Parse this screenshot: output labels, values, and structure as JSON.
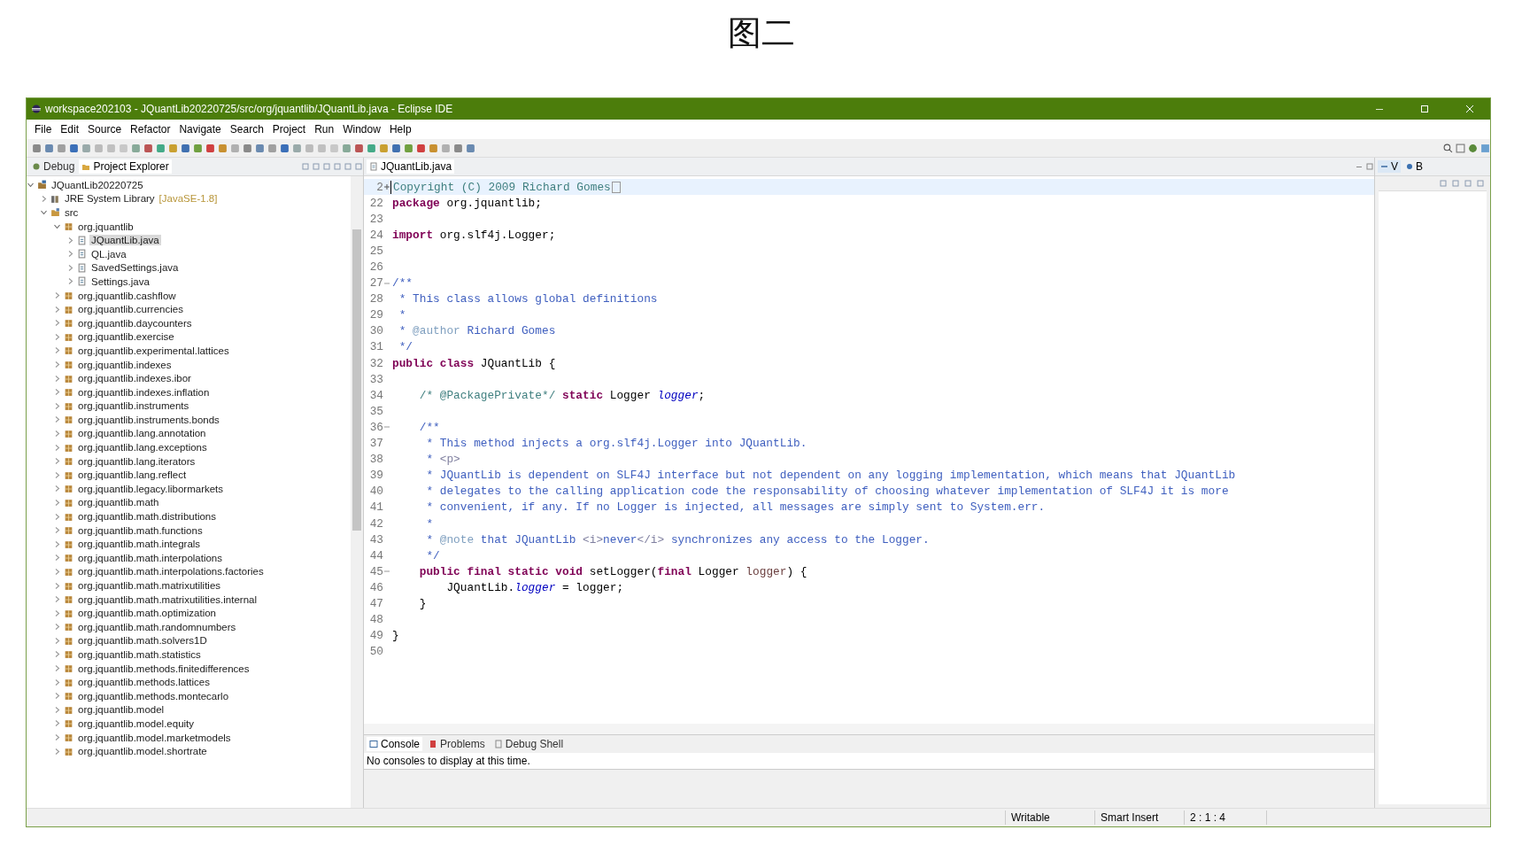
{
  "caption": "图二",
  "window": {
    "title": "workspace202103 - JQuantLib20220725/src/org/jquantlib/JQuantLib.java - Eclipse IDE"
  },
  "menu": [
    "File",
    "Edit",
    "Source",
    "Refactor",
    "Navigate",
    "Search",
    "Project",
    "Run",
    "Window",
    "Help"
  ],
  "left_panel": {
    "tabs": [
      {
        "label": "Debug",
        "selected": false
      },
      {
        "label": "Project Explorer",
        "selected": true
      }
    ],
    "tree": [
      {
        "label": "JQuantLib20220725",
        "kind": "project",
        "expanded": true,
        "selected": false,
        "children": [
          {
            "label": "JRE System Library",
            "decoration": "[JavaSE-1.8]",
            "kind": "library",
            "expanded": false,
            "selected": false
          },
          {
            "label": "src",
            "kind": "folder",
            "expanded": true,
            "selected": false,
            "children": [
              {
                "label": "org.jquantlib",
                "kind": "package",
                "expanded": true,
                "selected": false,
                "children": [
                  {
                    "label": "JQuantLib.java",
                    "kind": "file",
                    "expanded": false,
                    "selected": true
                  },
                  {
                    "label": "QL.java",
                    "kind": "file",
                    "expanded": false,
                    "selected": false
                  },
                  {
                    "label": "SavedSettings.java",
                    "kind": "file",
                    "expanded": false,
                    "selected": false
                  },
                  {
                    "label": "Settings.java",
                    "kind": "file",
                    "expanded": false,
                    "selected": false
                  }
                ]
              },
              {
                "label": "org.jquantlib.cashflow",
                "kind": "package",
                "expanded": false,
                "selected": false
              },
              {
                "label": "org.jquantlib.currencies",
                "kind": "package",
                "expanded": false,
                "selected": false
              },
              {
                "label": "org.jquantlib.daycounters",
                "kind": "package",
                "expanded": false,
                "selected": false
              },
              {
                "label": "org.jquantlib.exercise",
                "kind": "package",
                "expanded": false,
                "selected": false
              },
              {
                "label": "org.jquantlib.experimental.lattices",
                "kind": "package",
                "expanded": false,
                "selected": false
              },
              {
                "label": "org.jquantlib.indexes",
                "kind": "package",
                "expanded": false,
                "selected": false
              },
              {
                "label": "org.jquantlib.indexes.ibor",
                "kind": "package",
                "expanded": false,
                "selected": false
              },
              {
                "label": "org.jquantlib.indexes.inflation",
                "kind": "package",
                "expanded": false,
                "selected": false
              },
              {
                "label": "org.jquantlib.instruments",
                "kind": "package",
                "expanded": false,
                "selected": false
              },
              {
                "label": "org.jquantlib.instruments.bonds",
                "kind": "package",
                "expanded": false,
                "selected": false
              },
              {
                "label": "org.jquantlib.lang.annotation",
                "kind": "package",
                "expanded": false,
                "selected": false
              },
              {
                "label": "org.jquantlib.lang.exceptions",
                "kind": "package",
                "expanded": false,
                "selected": false
              },
              {
                "label": "org.jquantlib.lang.iterators",
                "kind": "package",
                "expanded": false,
                "selected": false
              },
              {
                "label": "org.jquantlib.lang.reflect",
                "kind": "package",
                "expanded": false,
                "selected": false
              },
              {
                "label": "org.jquantlib.legacy.libormarkets",
                "kind": "package",
                "expanded": false,
                "selected": false
              },
              {
                "label": "org.jquantlib.math",
                "kind": "package",
                "expanded": false,
                "selected": false
              },
              {
                "label": "org.jquantlib.math.distributions",
                "kind": "package",
                "expanded": false,
                "selected": false
              },
              {
                "label": "org.jquantlib.math.functions",
                "kind": "package",
                "expanded": false,
                "selected": false
              },
              {
                "label": "org.jquantlib.math.integrals",
                "kind": "package",
                "expanded": false,
                "selected": false
              },
              {
                "label": "org.jquantlib.math.interpolations",
                "kind": "package",
                "expanded": false,
                "selected": false
              },
              {
                "label": "org.jquantlib.math.interpolations.factories",
                "kind": "package",
                "expanded": false,
                "selected": false
              },
              {
                "label": "org.jquantlib.math.matrixutilities",
                "kind": "package",
                "expanded": false,
                "selected": false
              },
              {
                "label": "org.jquantlib.math.matrixutilities.internal",
                "kind": "package",
                "expanded": false,
                "selected": false
              },
              {
                "label": "org.jquantlib.math.optimization",
                "kind": "package",
                "expanded": false,
                "selected": false
              },
              {
                "label": "org.jquantlib.math.randomnumbers",
                "kind": "package",
                "expanded": false,
                "selected": false
              },
              {
                "label": "org.jquantlib.math.solvers1D",
                "kind": "package",
                "expanded": false,
                "selected": false
              },
              {
                "label": "org.jquantlib.math.statistics",
                "kind": "package",
                "expanded": false,
                "selected": false
              },
              {
                "label": "org.jquantlib.methods.finitedifferences",
                "kind": "package",
                "expanded": false,
                "selected": false
              },
              {
                "label": "org.jquantlib.methods.lattices",
                "kind": "package",
                "expanded": false,
                "selected": false
              },
              {
                "label": "org.jquantlib.methods.montecarlo",
                "kind": "package",
                "expanded": false,
                "selected": false
              },
              {
                "label": "org.jquantlib.model",
                "kind": "package",
                "expanded": false,
                "selected": false
              },
              {
                "label": "org.jquantlib.model.equity",
                "kind": "package",
                "expanded": false,
                "selected": false
              },
              {
                "label": "org.jquantlib.model.marketmodels",
                "kind": "package",
                "expanded": false,
                "selected": false
              },
              {
                "label": "org.jquantlib.model.shortrate",
                "kind": "package",
                "expanded": false,
                "selected": false
              }
            ]
          }
        ]
      }
    ]
  },
  "editor": {
    "tabs": [
      {
        "label": "JQuantLib.java",
        "selected": true
      }
    ],
    "lines": [
      {
        "num": "2",
        "folded": true,
        "current": true,
        "tokens": [
          {
            "kind": "comment",
            "text": "Copyright (C) 2009 Richard Gomes"
          }
        ]
      },
      {
        "num": "22",
        "tokens": [
          {
            "kind": "kw",
            "text": "package"
          },
          {
            "kind": "plain",
            "text": " org.jquantlib;"
          }
        ]
      },
      {
        "num": "23"
      },
      {
        "num": "24",
        "tokens": [
          {
            "kind": "kw",
            "text": "import"
          },
          {
            "kind": "plain",
            "text": " org.slf4j.Logger;"
          }
        ]
      },
      {
        "num": "25"
      },
      {
        "num": "26"
      },
      {
        "num": "27",
        "folded": false,
        "tokens": [
          {
            "kind": "doc",
            "text": "/**"
          }
        ]
      },
      {
        "num": "28",
        "tokens": [
          {
            "kind": "doc",
            "text": " * This class allows global definitions"
          }
        ]
      },
      {
        "num": "29",
        "tokens": [
          {
            "kind": "doc",
            "text": " *"
          }
        ]
      },
      {
        "num": "30",
        "tokens": [
          {
            "kind": "doc",
            "text": " * "
          },
          {
            "kind": "tag",
            "text": "@author"
          },
          {
            "kind": "doc",
            "text": " Richard Gomes"
          }
        ]
      },
      {
        "num": "31",
        "tokens": [
          {
            "kind": "doc",
            "text": " */"
          }
        ]
      },
      {
        "num": "32",
        "tokens": [
          {
            "kind": "kw",
            "text": "public class"
          },
          {
            "kind": "plain",
            "text": " JQuantLib {"
          }
        ]
      },
      {
        "num": "33"
      },
      {
        "num": "34",
        "tokens": [
          {
            "kind": "comment",
            "text": "    /* @PackagePrivate*/ "
          },
          {
            "kind": "kw",
            "text": "static"
          },
          {
            "kind": "plain",
            "text": " Logger "
          },
          {
            "kind": "field",
            "text": "logger"
          },
          {
            "kind": "plain",
            "text": ";"
          }
        ]
      },
      {
        "num": "35"
      },
      {
        "num": "36",
        "folded": false,
        "tokens": [
          {
            "kind": "doc",
            "text": "    /**"
          }
        ]
      },
      {
        "num": "37",
        "tokens": [
          {
            "kind": "doc",
            "text": "     * This method injects a org.slf4j.Logger into JQuantLib."
          }
        ]
      },
      {
        "num": "38",
        "tokens": [
          {
            "kind": "doc",
            "text": "     * "
          },
          {
            "kind": "html",
            "text": "<p>"
          }
        ]
      },
      {
        "num": "39",
        "tokens": [
          {
            "kind": "doc",
            "text": "     * JQuantLib is dependent on SLF4J interface but not dependent on any logging implementation, which means that JQuantLib"
          }
        ]
      },
      {
        "num": "40",
        "tokens": [
          {
            "kind": "doc",
            "text": "     * delegates to the calling application code the responsability of choosing whatever implementation of SLF4J it is more"
          }
        ]
      },
      {
        "num": "41",
        "tokens": [
          {
            "kind": "doc",
            "text": "     * convenient, if any. If no Logger is injected, all messages are simply sent to System.err."
          }
        ]
      },
      {
        "num": "42",
        "tokens": [
          {
            "kind": "doc",
            "text": "     *"
          }
        ]
      },
      {
        "num": "43",
        "tokens": [
          {
            "kind": "doc",
            "text": "     * "
          },
          {
            "kind": "tag",
            "text": "@note"
          },
          {
            "kind": "doc",
            "text": " that JQuantLib "
          },
          {
            "kind": "html",
            "text": "<i>"
          },
          {
            "kind": "doc",
            "text": "never"
          },
          {
            "kind": "html",
            "text": "</i>"
          },
          {
            "kind": "doc",
            "text": " synchronizes any access to the Logger."
          }
        ]
      },
      {
        "num": "44",
        "tokens": [
          {
            "kind": "doc",
            "text": "     */"
          }
        ]
      },
      {
        "num": "45",
        "folded": false,
        "tokens": [
          {
            "kind": "kw",
            "text": "    public final static void"
          },
          {
            "kind": "plain",
            "text": " setLogger("
          },
          {
            "kind": "kw",
            "text": "final"
          },
          {
            "kind": "plain",
            "text": " Logger "
          },
          {
            "kind": "param",
            "text": "logger"
          },
          {
            "kind": "plain",
            "text": ") {"
          }
        ]
      },
      {
        "num": "46",
        "tokens": [
          {
            "kind": "plain",
            "text": "        JQuantLib."
          },
          {
            "kind": "field",
            "text": "logger"
          },
          {
            "kind": "plain",
            "text": " = logger;"
          }
        ]
      },
      {
        "num": "47",
        "tokens": [
          {
            "kind": "plain",
            "text": "    }"
          }
        ]
      },
      {
        "num": "48"
      },
      {
        "num": "49",
        "tokens": [
          {
            "kind": "plain",
            "text": "}"
          }
        ]
      },
      {
        "num": "50"
      }
    ]
  },
  "bottom_panel": {
    "tabs": [
      {
        "label": "Console",
        "selected": true
      },
      {
        "label": "Problems",
        "selected": false
      },
      {
        "label": "Debug Shell",
        "selected": false
      }
    ],
    "message": "No consoles to display at this time."
  },
  "right_panel": {
    "tabs": [
      {
        "label": "V",
        "selected": true
      },
      {
        "label": "B",
        "selected": false
      }
    ]
  },
  "status_bar": [
    "Writable",
    "Smart Insert",
    "2 : 1 : 4"
  ]
}
